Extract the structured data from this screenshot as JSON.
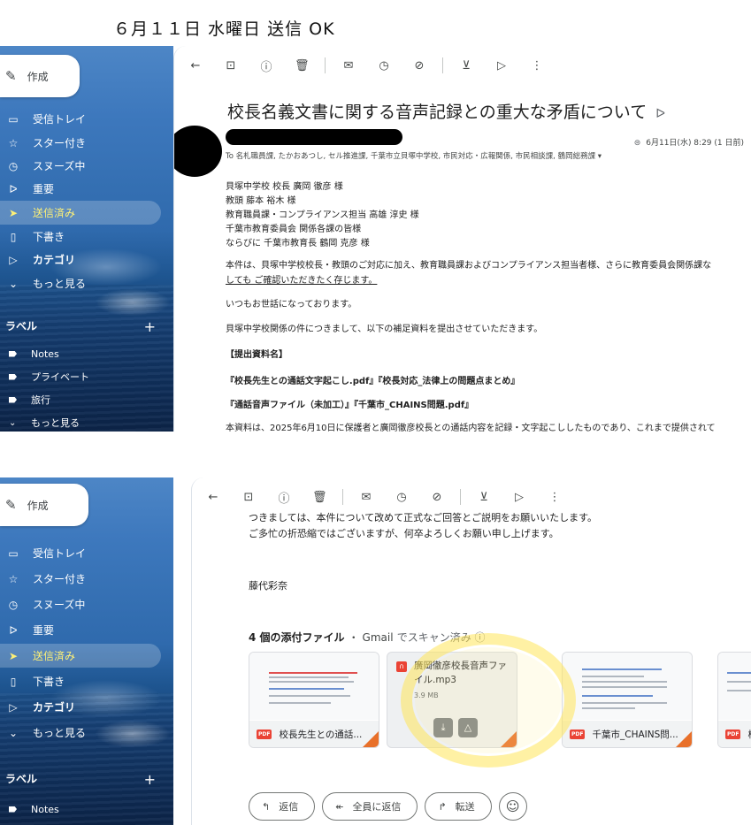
{
  "caption": "６月１１日 水曜日 送信 OK",
  "sidebar": {
    "compose_label": "作成",
    "items": [
      {
        "label": "受信トレイ",
        "icon": "inbox-icon"
      },
      {
        "label": "スター付き",
        "icon": "star-icon"
      },
      {
        "label": "スヌーズ中",
        "icon": "clock-icon"
      },
      {
        "label": "重要",
        "icon": "important-icon"
      },
      {
        "label": "送信済み",
        "icon": "send-icon"
      },
      {
        "label": "下書き",
        "icon": "draft-icon"
      },
      {
        "label": "カテゴリ",
        "icon": "category-icon"
      },
      {
        "label": "もっと見る",
        "icon": "chevron-down-icon"
      }
    ],
    "labels_heading": "ラベル",
    "labels_plus": "+",
    "labels": [
      "Notes",
      "プライベート",
      "旅行",
      "もっと見る"
    ]
  },
  "email": {
    "subject": "校長名義文書に関する音声記録との重大な矛盾について",
    "date": "6月11日(水) 8:29 (1 日前)",
    "to_line": "To 名札職員課, たかおあつし, セル推進課, 千葉市立貝塚中学校, 市民対応・広報関係, 市民相談課, 鶴岡総務課 ▾",
    "body": [
      "貝塚中学校 校長 廣岡 徹彦 様",
      "教頭 藤本 裕木 様",
      "教育職員課・コンプライアンス担当 高雄 淳史 様",
      "千葉市教育委員会 関係各課の皆様",
      "ならびに 千葉市教育長 鶴岡 克彦 様",
      "本件は、貝塚中学校校長・教頭のご対応に加え、教育職員課およびコンプライアンス担当者様、さらに教育委員会関係課な",
      "しても ご確認いただきたく存じます。",
      "いつもお世話になっております。",
      "貝塚中学校関係の件につきまして、以下の補足資料を提出させていただきます。",
      "【提出資料名】",
      "『校長先生との通話文字起こし.pdf』『校長対応_法律上の問題点まとめ』",
      "『通話音声ファイル（未加工）』『千葉市_CHAINS問題.pdf』",
      "本資料は、2025年6月10日に保護者と廣岡徹彦校長との通話内容を記録・文字起こししたものであり、これまで提供されて"
    ],
    "body2": [
      "つきましては、本件について改めて正式なご回答とご説明をお願いいたします。",
      "ご多忙の折恐縮ではございますが、何卒よろしくお願い申し上げます。",
      "藤代彩奈"
    ],
    "attachments_title": "4 個の添付ファイル",
    "attachments_gmail": "・ Gmail",
    "attachments_scan": "でスキャン済み ⓘ",
    "attachments": [
      {
        "name": "校長先生との通話..."
      },
      {
        "name": "廣岡徹彦校長音声ファイル.mp3",
        "size": "3.9 MB"
      },
      {
        "name": "千葉市_CHAINS問..."
      },
      {
        "name": "校"
      }
    ],
    "pdf_badge": "PDF",
    "reply": {
      "reply": "返信",
      "reply_all": "全員に返信",
      "forward": "転送"
    }
  }
}
